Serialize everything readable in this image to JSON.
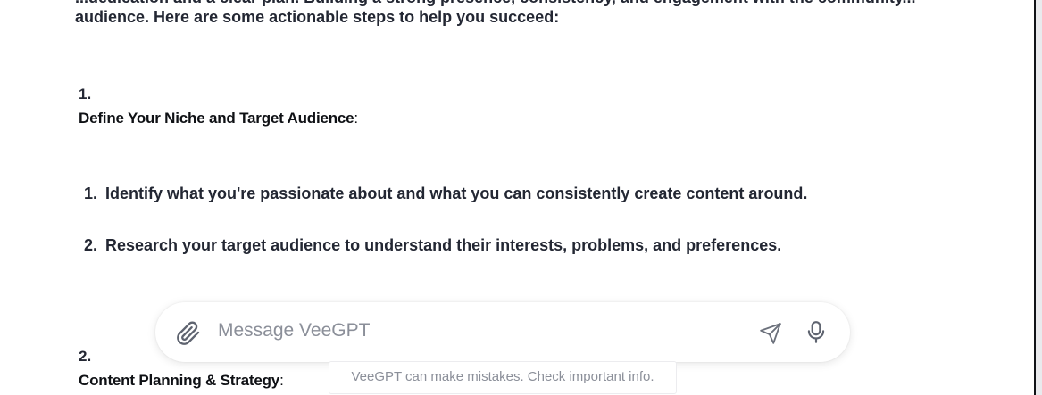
{
  "message": {
    "intro_cut": "...dedication and a clear plan. Building a strong presence, consistency, and engagement with the community...",
    "intro_end": "audience. Here are some actionable steps to help you succeed:",
    "sections": [
      {
        "number": "1.",
        "title": "Define Your Niche and Target Audience",
        "colon": ":",
        "items": [
          {
            "n": "1.",
            "text": "Identify what you're passionate about and what you can consistently create content around."
          },
          {
            "n": "2.",
            "text": "Research your target audience to understand their interests, problems, and preferences."
          }
        ]
      },
      {
        "number": "2.",
        "title": "Content Planning & Strategy",
        "colon": ":"
      }
    ]
  },
  "composer": {
    "placeholder": "Message VeeGPT",
    "attach_icon": "paperclip-icon",
    "send_icon": "send-icon",
    "mic_icon": "microphone-icon"
  },
  "disclaimer": "VeeGPT can make mistakes. Check important info."
}
